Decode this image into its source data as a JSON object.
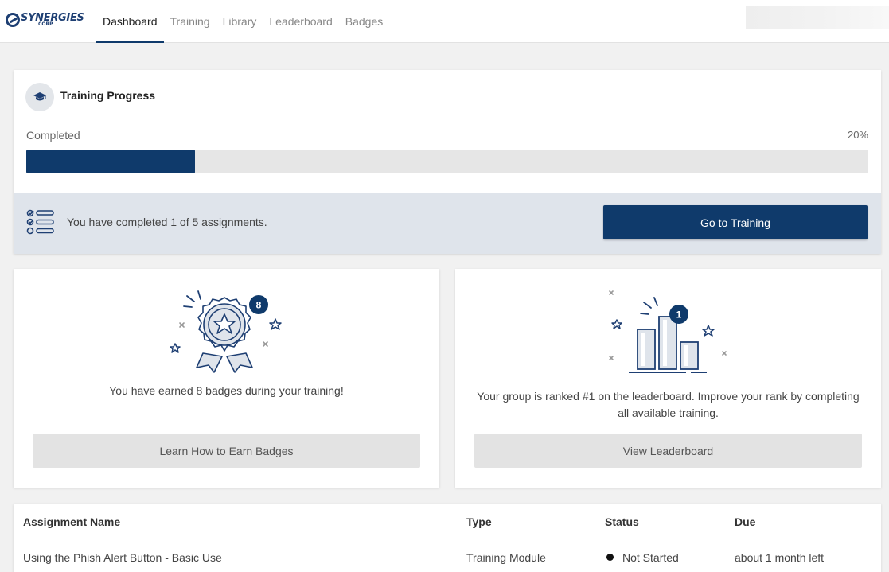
{
  "brand": {
    "name": "SYNERGIES",
    "sub": "CORP."
  },
  "nav": {
    "items": [
      {
        "label": "Dashboard",
        "active": true
      },
      {
        "label": "Training",
        "active": false
      },
      {
        "label": "Library",
        "active": false
      },
      {
        "label": "Leaderboard",
        "active": false
      },
      {
        "label": "Badges",
        "active": false
      }
    ]
  },
  "progress": {
    "title": "Training Progress",
    "completed_label": "Completed",
    "percent_text": "20%",
    "percent_value": 0.2,
    "summary": "You have completed 1 of 5 assignments.",
    "button_label": "Go to Training"
  },
  "badges_card": {
    "badge_count": "8",
    "text": "You have earned 8 badges during your training!",
    "button_label": "Learn How to Earn Badges"
  },
  "leaderboard_card": {
    "rank": "1",
    "text": "Your group is ranked #1 on the leaderboard. Improve your rank by completing all available training.",
    "button_label": "View Leaderboard"
  },
  "assignments": {
    "headers": {
      "name": "Assignment Name",
      "type": "Type",
      "status": "Status",
      "due": "Due"
    },
    "rows": [
      {
        "name": "Using the Phish Alert Button - Basic Use",
        "type": "Training Module",
        "status": "Not Started",
        "due": "about 1 month left"
      }
    ]
  },
  "colors": {
    "primary": "#0f3a6b",
    "accent": "#1e3f73",
    "footer_bg": "#dfe4eb",
    "button_grey": "#e3e3e3"
  }
}
